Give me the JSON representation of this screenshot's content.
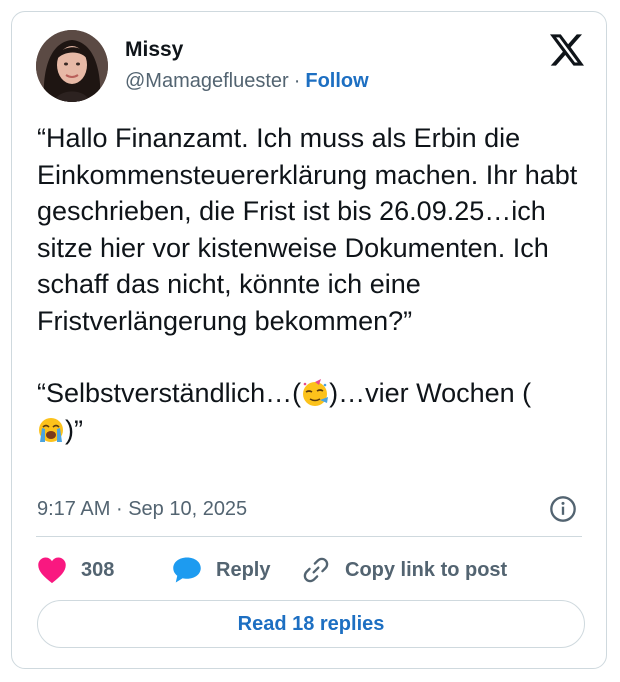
{
  "author": {
    "name": "Missy",
    "handle": "@Mamagefluester",
    "separator": "·",
    "follow_label": "Follow"
  },
  "tweet": {
    "paragraph1": "“Hallo Finanzamt. Ich muss als Erbin die Einkommensteuererklärung machen. Ihr habt geschrieben, die Frist ist bis 26.09.25…ich sitze hier vor kistenweise Dokumenten. Ich schaff das nicht, könnte ich eine Fristverlängerung bekommen?”",
    "paragraph2_part1": "“Selbstverständlich…(",
    "emoji1": "partying-face-emoji",
    "paragraph2_part2": ")…vier Wochen (",
    "emoji2": "loudly-crying-face-emoji",
    "paragraph2_part3": ")”"
  },
  "meta": {
    "time": "9:17 AM",
    "separator": "·",
    "date": "Sep 10, 2025"
  },
  "actions": {
    "like_count": "308",
    "reply_label": "Reply",
    "copy_label": "Copy link to post"
  },
  "read_replies_label": "Read 18 replies",
  "colors": {
    "accent": "#1d6fc2",
    "heart": "#f91880",
    "reply_bubble": "#1d9bf0",
    "secondary_text": "#536471",
    "border": "#cfd9de"
  }
}
